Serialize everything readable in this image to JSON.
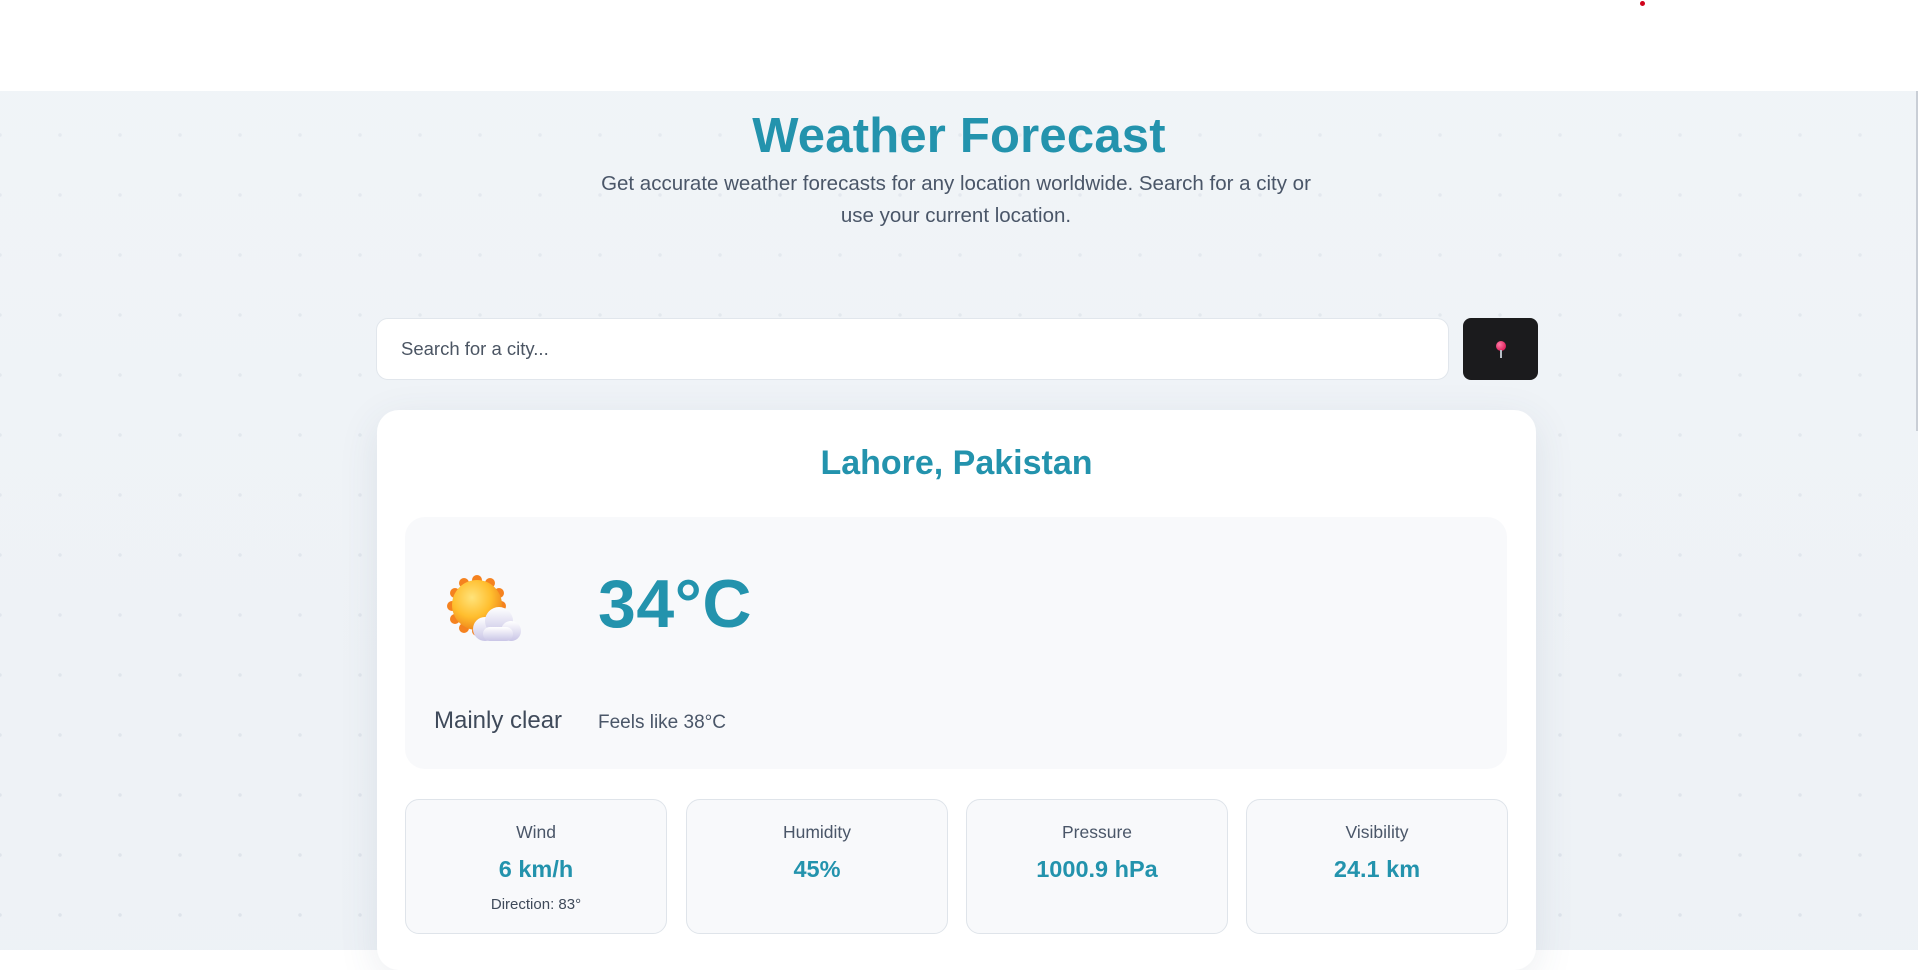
{
  "header": {
    "title": "Weather Forecast",
    "subtitle": "Get accurate weather forecasts for any location worldwide. Search for a city or use your current location."
  },
  "search": {
    "placeholder": "Search for a city...",
    "value": "",
    "location_button_icon": "location-pin-icon"
  },
  "weather": {
    "city": "Lahore, Pakistan",
    "icon": "sun-behind-cloud-icon",
    "temperature": "34°C",
    "condition": "Mainly clear",
    "feels_like": "Feels like 38°C"
  },
  "stats": [
    {
      "label": "Wind",
      "value": "6 km/h",
      "sub": "Direction: 83°"
    },
    {
      "label": "Humidity",
      "value": "45%"
    },
    {
      "label": "Pressure",
      "value": "1000.9 hPa"
    },
    {
      "label": "Visibility",
      "value": "24.1 km"
    }
  ],
  "colors": {
    "accent": "#2393ad",
    "button_bg": "#1b1b1d",
    "page_bg": "#eef2f6"
  }
}
